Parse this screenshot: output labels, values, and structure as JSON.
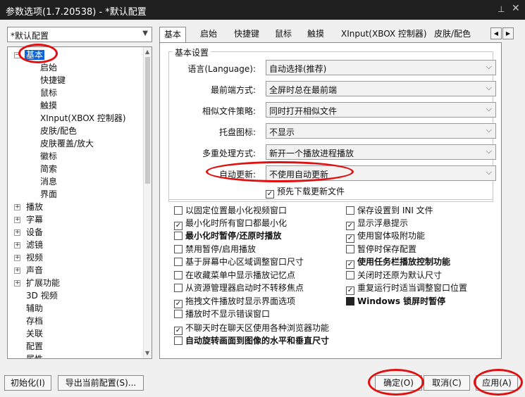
{
  "window": {
    "title": "参数选项(1.7.20538) - *默认配置"
  },
  "profile": {
    "selected": "*默认配置"
  },
  "tree": {
    "items": [
      "基本",
      "启始",
      "快捷键",
      "鼠标",
      "触摸",
      "XInput(XBOX 控制器)",
      "皮肤/配色",
      "皮肤覆盖/放大",
      "徽标",
      "简索",
      "消息",
      "界面",
      "播放",
      "字幕",
      "设备",
      "滤镜",
      "视频",
      "声音",
      "扩展功能",
      "3D 视频",
      "辅助",
      "存档",
      "关联",
      "配置",
      "属性"
    ]
  },
  "tabs": [
    "基本",
    "启始",
    "快捷键",
    "鼠标",
    "触摸",
    "XInput(XBOX 控制器)",
    "皮肤/配色"
  ],
  "basic": {
    "group_title": "基本设置",
    "settings": [
      {
        "label": "语言(Language):",
        "value": "自动选择(推荐)"
      },
      {
        "label": "最前端方式:",
        "value": "全屏时总在最前端"
      },
      {
        "label": "相似文件策略:",
        "value": "同时打开相似文件"
      },
      {
        "label": "托盘图标:",
        "value": "不显示"
      },
      {
        "label": "多重处理方式:",
        "value": "新开一个播放进程播放"
      },
      {
        "label": "自动更新:",
        "value": "不使用自动更新"
      }
    ],
    "predownload": "预先下载更新文件"
  },
  "checks_left": [
    {
      "label": "以固定位置最小化视频窗口",
      "checked": false,
      "bold": false
    },
    {
      "label": "最小化时所有窗口都最小化",
      "checked": true,
      "bold": false
    },
    {
      "label": "最小化时暂停/还原时播放",
      "checked": false,
      "bold": true
    },
    {
      "label": "禁用暂停/启用播放",
      "checked": false,
      "bold": false
    },
    {
      "label": "基于屏幕中心区域调整窗口尺寸",
      "checked": false,
      "bold": false
    },
    {
      "label": "在收藏菜单中显示播放记忆点",
      "checked": false,
      "bold": false
    },
    {
      "label": "从资源管理器启动时不转移焦点",
      "checked": false,
      "bold": false
    },
    {
      "label": "拖拽文件播放时显示界面选项",
      "checked": true,
      "bold": false
    },
    {
      "label": "播放时不显示错误窗口",
      "checked": false,
      "bold": false
    },
    {
      "label": "不聊天时在聊天区使用各种浏览器功能",
      "checked": true,
      "bold": false
    },
    {
      "label": "自动旋转画面到图像的水平和垂直尺寸",
      "checked": false,
      "bold": true
    }
  ],
  "checks_right": [
    {
      "label": "保存设置到 INI 文件",
      "checked": false,
      "bold": false
    },
    {
      "label": "显示浮悬提示",
      "checked": true,
      "bold": false
    },
    {
      "label": "使用窗体吸附功能",
      "checked": true,
      "bold": false
    },
    {
      "label": "暂停时保存配置",
      "checked": false,
      "bold": false
    },
    {
      "label": "使用任务栏播放控制功能",
      "checked": true,
      "bold": true
    },
    {
      "label": "关闭时还原为默认尺寸",
      "checked": false,
      "bold": false
    },
    {
      "label": "重复运行时适当调整窗口位置",
      "checked": true,
      "bold": false
    },
    {
      "label": "Windows 锁屏时暂停",
      "checked": true,
      "bold": true,
      "filled": true
    }
  ],
  "buttons": {
    "init": "初始化(I)",
    "export": "导出当前配置(S)...",
    "ok": "确定(O)",
    "cancel": "取消(C)",
    "apply": "应用(A)"
  }
}
